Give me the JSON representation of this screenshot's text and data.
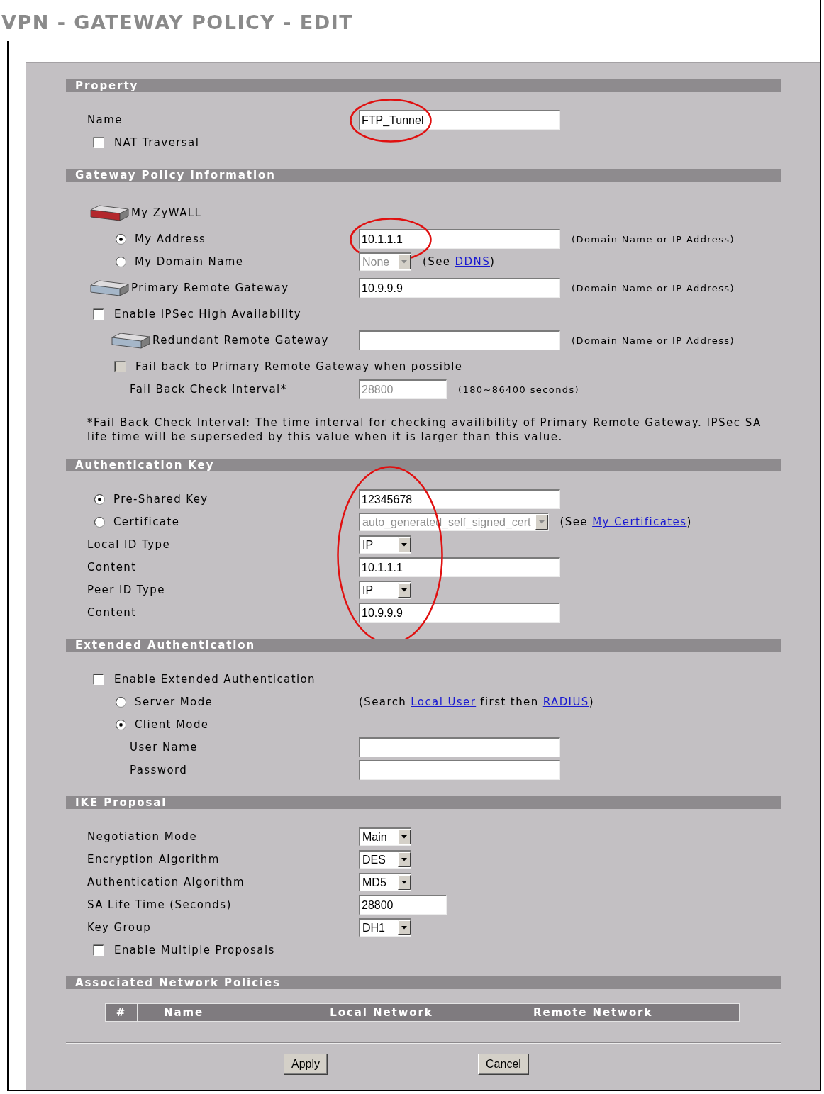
{
  "page_title": "VPN - GATEWAY POLICY - EDIT",
  "sections": [
    {
      "kind": "form",
      "title": "Property",
      "circled": false,
      "rows": [
        {
          "kind": "label",
          "label": "Name",
          "control": {
            "kind": "text",
            "value": "FTP_Tunnel",
            "disabled": false,
            "circled": true
          }
        },
        {
          "kind": "checkbox",
          "label": "NAT Traversal",
          "checked": false,
          "disabled": false
        }
      ]
    },
    {
      "kind": "form",
      "title": "Gateway Policy Information",
      "circled": false,
      "rows": [
        {
          "kind": "device",
          "color": "#b3282d",
          "label": "My ZyWALL",
          "children": [
            {
              "kind": "radio",
              "label": "My Address",
              "selected": true,
              "control": {
                "kind": "text",
                "value": "10.1.1.1",
                "disabled": false,
                "circled": true
              },
              "note": {
                "kind": "hint",
                "parts": [
                  {
                    "kind": "text",
                    "text": "(Domain Name or IP Address)"
                  }
                ]
              }
            },
            {
              "kind": "radio",
              "label": "My Domain Name",
              "selected": false,
              "control": {
                "kind": "select",
                "value": "None",
                "disabled": true,
                "circled": false
              },
              "note": {
                "kind": "reference",
                "parts": [
                  {
                    "kind": "text",
                    "text": "(See "
                  },
                  {
                    "kind": "link",
                    "text": "DDNS"
                  },
                  {
                    "kind": "text",
                    "text": ")"
                  }
                ]
              }
            }
          ]
        },
        {
          "kind": "device",
          "color": "#a5b6c8",
          "label": "Primary Remote Gateway",
          "control": {
            "kind": "text",
            "value": "10.9.9.9",
            "disabled": false,
            "circled": false
          },
          "note": {
            "kind": "hint",
            "parts": [
              {
                "kind": "text",
                "text": "(Domain Name or IP Address)"
              }
            ]
          }
        },
        {
          "kind": "checkbox",
          "label": "Enable IPSec High Availability",
          "checked": false,
          "disabled": false,
          "children": [
            {
              "kind": "device",
              "color": "#a5b6c8",
              "label": "Redundant Remote Gateway",
              "control": {
                "kind": "text",
                "disabled": false,
                "circled": false
              },
              "note": {
                "kind": "hint",
                "parts": [
                  {
                    "kind": "text",
                    "text": "(Domain Name or IP Address)"
                  }
                ]
              }
            },
            {
              "kind": "checkbox",
              "label": "Fail back to Primary Remote Gateway when possible",
              "checked": false,
              "disabled": true,
              "children": [
                {
                  "kind": "label",
                  "label": "Fail Back Check Interval*",
                  "control": {
                    "kind": "number",
                    "value": "28800",
                    "disabled": true,
                    "circled": false
                  },
                  "note": {
                    "kind": "hint",
                    "parts": [
                      {
                        "kind": "text",
                        "text": "(180~86400 seconds)"
                      }
                    ]
                  }
                }
              ]
            }
          ]
        }
      ],
      "footnote": "*Fail Back Check Interval: The time interval for checking availibility of Primary Remote Gateway. IPSec SA life time will be superseded by this value when it is larger than this value."
    },
    {
      "kind": "form",
      "title": "Authentication Key",
      "circled": true,
      "rows": [
        {
          "kind": "radio",
          "label": "Pre-Shared Key",
          "selected": true,
          "control": {
            "kind": "text",
            "value": "12345678",
            "disabled": false,
            "circled": false
          }
        },
        {
          "kind": "radio",
          "label": "Certificate",
          "selected": false,
          "control": {
            "kind": "select",
            "value": "auto_generated_self_signed_cert",
            "disabled": true,
            "circled": false
          },
          "note": {
            "kind": "reference",
            "parts": [
              {
                "kind": "text",
                "text": "(See "
              },
              {
                "kind": "link",
                "text": "My Certificates"
              },
              {
                "kind": "text",
                "text": ")"
              }
            ]
          }
        },
        {
          "kind": "label",
          "label": "Local ID Type",
          "control": {
            "kind": "select",
            "value": "IP",
            "disabled": false,
            "circled": false
          }
        },
        {
          "kind": "label",
          "label": "Content",
          "control": {
            "kind": "text",
            "value": "10.1.1.1",
            "disabled": false,
            "circled": false
          }
        },
        {
          "kind": "label",
          "label": "Peer ID Type",
          "control": {
            "kind": "select",
            "value": "IP",
            "disabled": false,
            "circled": false
          }
        },
        {
          "kind": "label",
          "label": "Content",
          "control": {
            "kind": "text",
            "value": "10.9.9.9",
            "disabled": false,
            "circled": false
          }
        }
      ]
    },
    {
      "kind": "form",
      "title": "Extended Authentication",
      "circled": false,
      "rows": [
        {
          "kind": "checkbox",
          "label": "Enable Extended Authentication",
          "checked": false,
          "disabled": false,
          "children": [
            {
              "kind": "radio",
              "label": "Server Mode",
              "selected": false,
              "note": {
                "kind": "reference",
                "parts": [
                  {
                    "kind": "text",
                    "text": "(Search "
                  },
                  {
                    "kind": "link",
                    "text": "Local User"
                  },
                  {
                    "kind": "text",
                    "text": " first then "
                  },
                  {
                    "kind": "link",
                    "text": "RADIUS"
                  },
                  {
                    "kind": "text",
                    "text": ")"
                  }
                ]
              }
            },
            {
              "kind": "radio",
              "label": "Client Mode",
              "selected": true,
              "children": [
                {
                  "kind": "label",
                  "label": "User Name",
                  "control": {
                    "kind": "text",
                    "disabled": false,
                    "circled": false
                  }
                },
                {
                  "kind": "label",
                  "label": "Password",
                  "control": {
                    "kind": "text",
                    "disabled": false,
                    "circled": false
                  }
                }
              ]
            }
          ]
        }
      ]
    },
    {
      "kind": "form",
      "title": "IKE Proposal",
      "circled": false,
      "rows": [
        {
          "kind": "label",
          "label": "Negotiation Mode",
          "control": {
            "kind": "select",
            "value": "Main",
            "disabled": false,
            "circled": false
          }
        },
        {
          "kind": "label",
          "label": "Encryption Algorithm",
          "control": {
            "kind": "select",
            "value": "DES",
            "disabled": false,
            "circled": false
          }
        },
        {
          "kind": "label",
          "label": "Authentication Algorithm",
          "control": {
            "kind": "select",
            "value": "MD5",
            "disabled": false,
            "circled": false
          }
        },
        {
          "kind": "label",
          "label": "SA Life Time (Seconds)",
          "control": {
            "kind": "number",
            "value": "28800",
            "disabled": false,
            "circled": false
          }
        },
        {
          "kind": "label",
          "label": "Key Group",
          "control": {
            "kind": "select",
            "value": "DH1",
            "disabled": false,
            "circled": false
          }
        },
        {
          "kind": "checkbox",
          "label": "Enable Multiple Proposals",
          "checked": false,
          "disabled": false
        }
      ]
    },
    {
      "kind": "table",
      "title": "Associated Network Policies",
      "circled": false,
      "table": {
        "columns": [
          "#",
          "Name",
          "Local Network",
          "Remote Network"
        ]
      }
    }
  ],
  "buttons": [
    "Apply",
    "Cancel"
  ]
}
